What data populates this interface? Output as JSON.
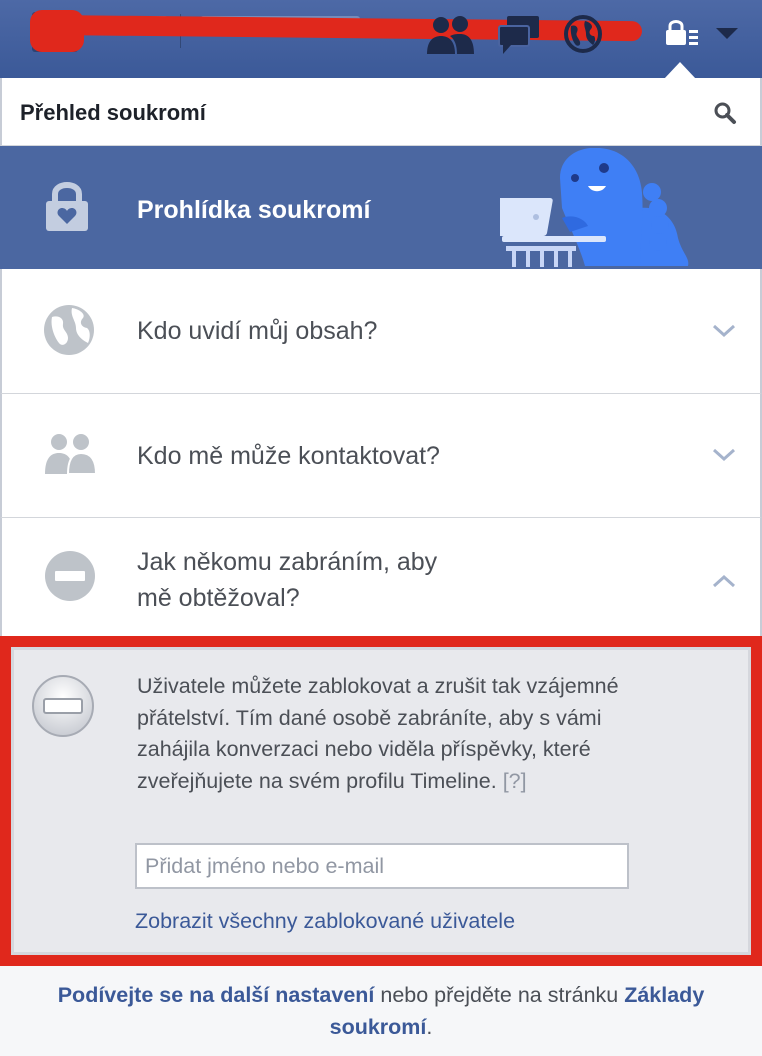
{
  "top_bar": {
    "icons": [
      "friend-requests-icon",
      "messages-icon",
      "notifications-globe-icon",
      "privacy-shortcuts-icon",
      "account-menu-chevron-icon"
    ]
  },
  "panel": {
    "title": "Přehled soukromí",
    "search_icon": "search-icon"
  },
  "privacy_tour": {
    "label": "Prohlídka soukromí",
    "icon": "lock-heart-icon"
  },
  "sections": [
    {
      "label": "Kdo uvidí můj obsah?",
      "icon": "globe-icon",
      "expanded": false
    },
    {
      "label": "Kdo mě může kontaktovat?",
      "icon": "people-icon",
      "expanded": false
    },
    {
      "label_line1": "Jak někomu zabráním, aby",
      "label_line2": "mě obtěžoval?",
      "icon": "block-icon",
      "expanded": true
    }
  ],
  "block_section": {
    "description": "Uživatele můžete zablokovat a zrušit tak vzájemné přátelství. Tím dané osobě zabráníte, aby s vámi zahájila konverzaci nebo viděla příspěvky, které zveřejňujete na svém profilu Timeline.",
    "help_link": "[?]",
    "input_value": "",
    "input_placeholder": "Přidat jméno nebo e-mail",
    "view_blocked_link": "Zobrazit všechny zablokované uživatele"
  },
  "footer": {
    "link_more_settings": "Podívejte se na další nastavení",
    "middle_text": " nebo přejděte na stránku ",
    "link_privacy_basics": "Základy soukromí",
    "end": "."
  },
  "colors": {
    "facebook_blue": "#3b5998",
    "tour_blue": "#4b67a1",
    "highlight_red": "#e0281c"
  }
}
